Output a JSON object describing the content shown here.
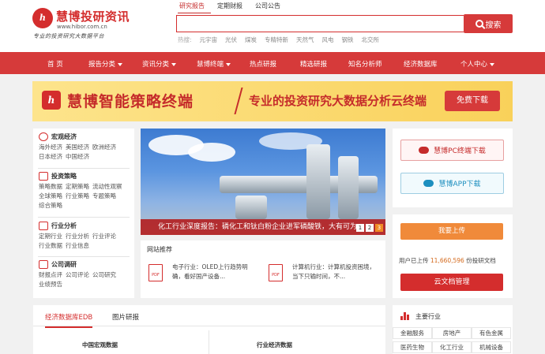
{
  "logo": {
    "mark": "h",
    "name": "慧博投研资讯",
    "url": "www.hibor.com.cn",
    "slogan": "专业的投资研究大数据平台"
  },
  "search": {
    "tabs": [
      "研究报告",
      "定期财报",
      "公司公告"
    ],
    "active_tab": 0,
    "placeholder": "",
    "button_label": "搜索",
    "hot_label": "热搜:",
    "hot_words": [
      "元宇宙",
      "光伏",
      "煤炭",
      "专精特新",
      "天然气",
      "风电",
      "钢铁",
      "北交所"
    ]
  },
  "nav": {
    "items": [
      {
        "label": "首 页",
        "dropdown": false
      },
      {
        "label": "报告分类",
        "dropdown": true
      },
      {
        "label": "资讯分类",
        "dropdown": true
      },
      {
        "label": "慧博终端",
        "dropdown": true
      },
      {
        "label": "热点研报",
        "dropdown": false
      },
      {
        "label": "精选研报",
        "dropdown": false
      },
      {
        "label": "知名分析师",
        "dropdown": false
      },
      {
        "label": "经济数据库",
        "dropdown": false
      },
      {
        "label": "个人中心",
        "dropdown": true
      }
    ]
  },
  "banner": {
    "logo_mark": "h",
    "title": "慧博智能策略终端",
    "slogan": "专业的投资研究大数据分析云终端",
    "button": "免费下载"
  },
  "categories": [
    {
      "title": "宏观经济",
      "icon": "globe-icon",
      "links": [
        "海外经济",
        "美国经济",
        "欧洲经济",
        "日本经济",
        "中国经济"
      ]
    },
    {
      "title": "投资策略",
      "icon": "strategy-icon",
      "links": [
        "策略数据",
        "定期策略",
        "流动性观察",
        "全球策略",
        "行业策略",
        "专题策略",
        "综合策略"
      ]
    },
    {
      "title": "行业分析",
      "icon": "industry-icon",
      "links": [
        "定期行业",
        "行业分析",
        "行业评论",
        "行业数据",
        "行业信息"
      ]
    },
    {
      "title": "公司调研",
      "icon": "company-icon",
      "links": [
        "财报点评",
        "公司评论",
        "公司研究",
        "业绩预告"
      ]
    }
  ],
  "slider": {
    "caption": "化工行业深度报告：磷化工和钛白粉企业进军磷酸铁，大有可为",
    "pages": [
      "1",
      "2",
      "3"
    ],
    "active_page": 2
  },
  "recommend": {
    "title": "网站推荐",
    "items": [
      {
        "icon": "pdf-icon",
        "text": "电子行业：OLED上行趋势明确，看好国产设备..."
      },
      {
        "icon": "pdf-icon",
        "text": "计算机行业：计算机投资困境，当下只输时间，不..."
      }
    ]
  },
  "downloads": {
    "pc": "慧博PC终端下载",
    "app": "慧博APP下载",
    "pc_color": "#c52b2b",
    "app_color": "#1d8fbf"
  },
  "upload": {
    "button": "我要上传",
    "text_prefix": "用户已上传",
    "count": "11,660,596",
    "text_suffix": "份投研文档",
    "manage": "云文档管理"
  },
  "bottom": {
    "tabs": [
      "经济数据库EDB",
      "图片研报"
    ],
    "active_tab": 0,
    "sections": [
      "中国宏观数据",
      "行业经济数据"
    ]
  },
  "industries": {
    "title": "主要行业",
    "items": [
      "金融服务",
      "房地产",
      "有色金属",
      "医药生物",
      "化工行业",
      "机械设备"
    ]
  },
  "colors": {
    "brand": "#d63a3a",
    "accent": "#f08a3a"
  }
}
